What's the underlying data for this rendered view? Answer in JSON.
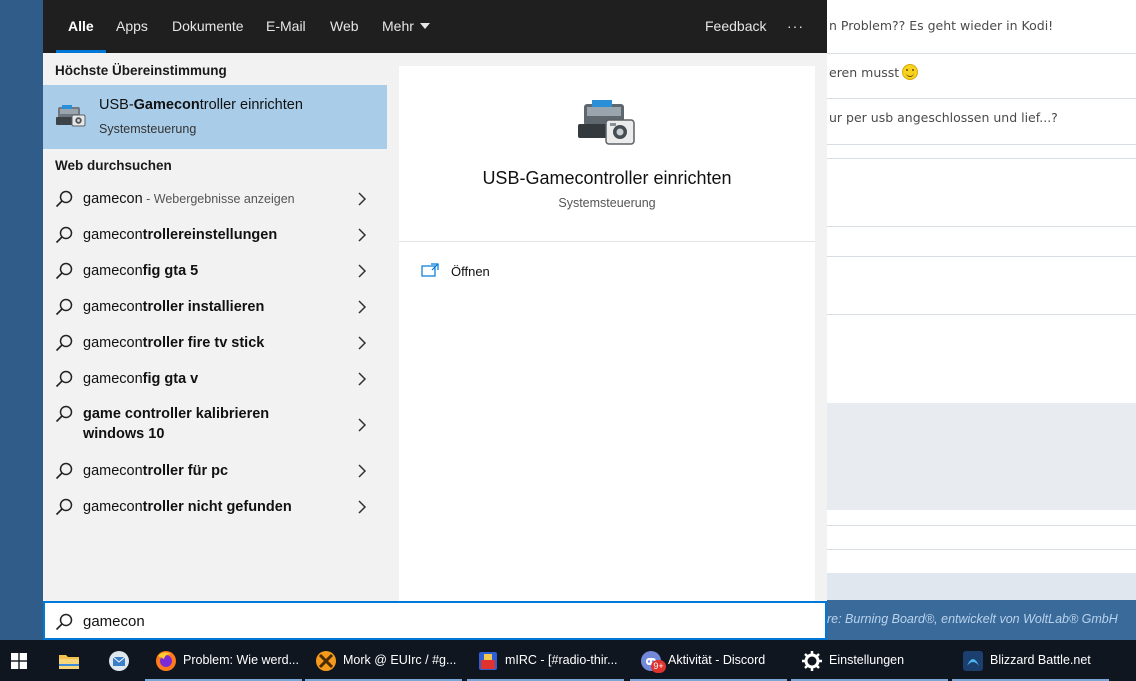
{
  "background_page": {
    "rows": [
      "n Problem?? Es geht wieder in Kodi!",
      "eren musst",
      "ur per usb angeschlossen und lief...?"
    ],
    "footer_text": "re: Burning Board®, entwickelt von WoltLab® GmbH"
  },
  "tabs": {
    "all": "Alle",
    "apps": "Apps",
    "documents": "Dokumente",
    "email": "E-Mail",
    "web": "Web",
    "more": "Mehr",
    "feedback": "Feedback",
    "options": "···"
  },
  "best_match": {
    "section_title": "Höchste Übereinstimmung",
    "title_prefix": "USB-",
    "title_bold": "Gamecon",
    "title_suffix": "troller einrichten",
    "subtitle": "Systemsteuerung"
  },
  "web_search": {
    "section_title": "Web durchsuchen",
    "items": [
      {
        "normal": "gamecon",
        "bold": "",
        "hint": " - Webergebnisse anzeigen"
      },
      {
        "normal": "gamecon",
        "bold": "trollereinstellungen",
        "hint": ""
      },
      {
        "normal": "gamecon",
        "bold": "fig gta 5",
        "hint": ""
      },
      {
        "normal": "gamecon",
        "bold": "troller installieren",
        "hint": ""
      },
      {
        "normal": "gamecon",
        "bold": "troller fire tv stick",
        "hint": ""
      },
      {
        "normal": "gamecon",
        "bold": "fig gta v",
        "hint": ""
      },
      {
        "normal": "",
        "bold": "game controller kalibrieren windows 10",
        "hint": ""
      },
      {
        "normal": "gamecon",
        "bold": "troller für pc",
        "hint": ""
      },
      {
        "normal": "gamecon",
        "bold": "troller nicht gefunden",
        "hint": ""
      }
    ]
  },
  "preview": {
    "title": "USB-Gamecontroller einrichten",
    "subtitle": "Systemsteuerung",
    "open_label": "Öffnen"
  },
  "search": {
    "value": "gamecon"
  },
  "taskbar": {
    "apps": [
      {
        "label": "Problem: Wie werd...",
        "icon": "firefox-icon"
      },
      {
        "label": "Mork @ EUIrc / #g...",
        "icon": "hexchat-icon"
      },
      {
        "label": "mIRC - [#radio-thir...",
        "icon": "mirc-icon"
      },
      {
        "label": "Aktivität - Discord",
        "icon": "discord-icon",
        "badge": "9+"
      },
      {
        "label": "Einstellungen",
        "icon": "gear-icon"
      },
      {
        "label": "Blizzard Battle.net",
        "icon": "battlenet-icon"
      }
    ]
  },
  "colors": {
    "accent": "#0078d7",
    "selection": "#a9cde9",
    "taskbar": "#101620"
  }
}
